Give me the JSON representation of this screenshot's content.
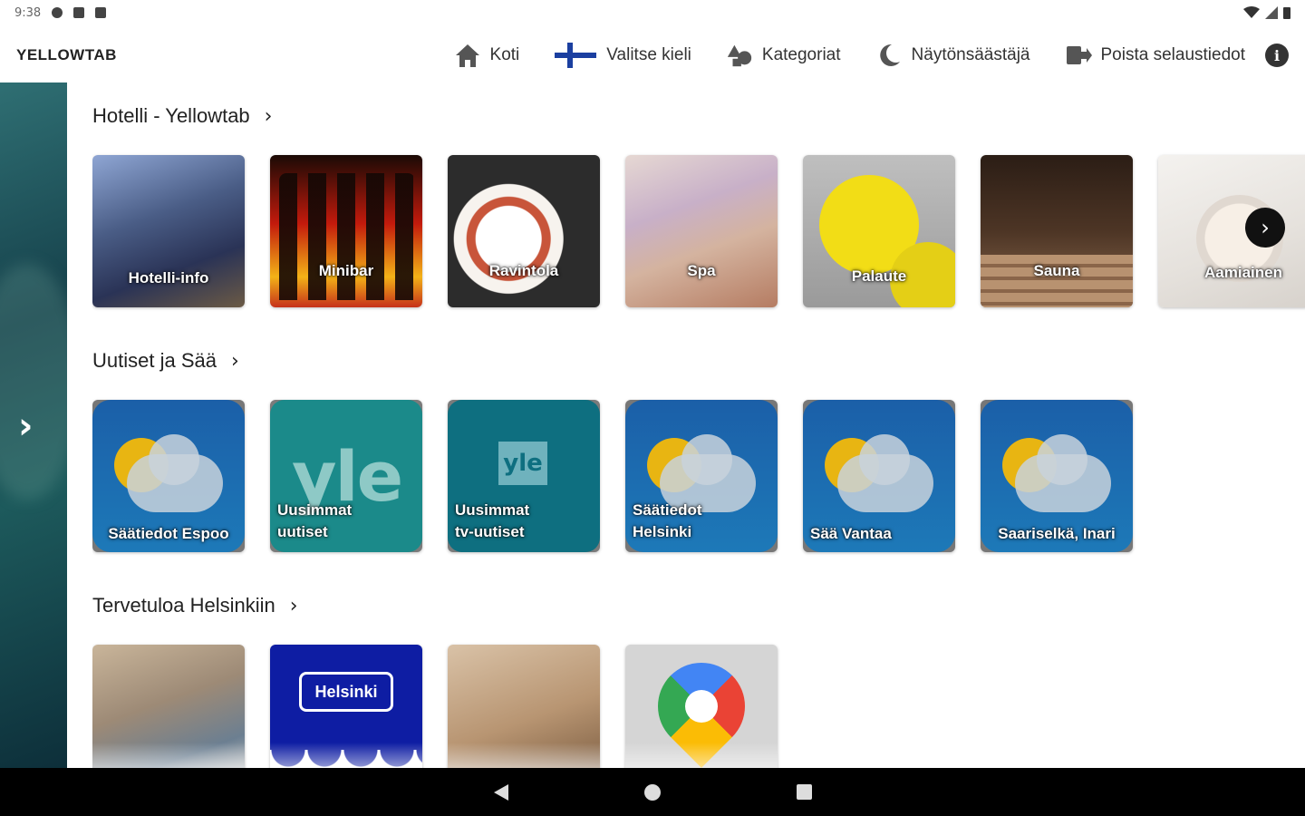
{
  "status": {
    "time": "9:38"
  },
  "header": {
    "brand": "YELLOWTAB",
    "nav": [
      {
        "label": "Koti",
        "icon": "home-icon"
      },
      {
        "label": "Valitse kieli",
        "icon": "finland-flag-icon"
      },
      {
        "label": "Kategoriat",
        "icon": "categories-icon"
      },
      {
        "label": "Näytönsäästäjä",
        "icon": "moon-icon"
      },
      {
        "label": "Poista selaustiedot",
        "icon": "logout-icon"
      }
    ],
    "info": "i"
  },
  "sections": [
    {
      "title": "Hotelli - Yellowtab",
      "tiles": [
        {
          "label": "Hotelli-info"
        },
        {
          "label": "Minibar"
        },
        {
          "label": "Ravintola"
        },
        {
          "label": "Spa"
        },
        {
          "label": "Palaute"
        },
        {
          "label": "Sauna"
        },
        {
          "label": "Aamiainen"
        }
      ]
    },
    {
      "title": "Uutiset ja Sää",
      "tiles": [
        {
          "label": "Säätiedot Espoo"
        },
        {
          "label_line1": "Uusimmat",
          "label_line2": "uutiset",
          "logo": "yle"
        },
        {
          "label_line1": "Uusimmat",
          "label_line2": "tv-uutiset",
          "logo": "yle"
        },
        {
          "label_line1": "Säätiedot",
          "label_line2": "Helsinki"
        },
        {
          "label": "Sää Vantaa"
        },
        {
          "label": "Saariselkä, Inari"
        }
      ]
    },
    {
      "title": "Tervetuloa Helsinkiin",
      "tiles": [
        {
          "label": ""
        },
        {
          "label": "",
          "badge": "Helsinki"
        },
        {
          "label": ""
        },
        {
          "label": ""
        }
      ]
    }
  ]
}
